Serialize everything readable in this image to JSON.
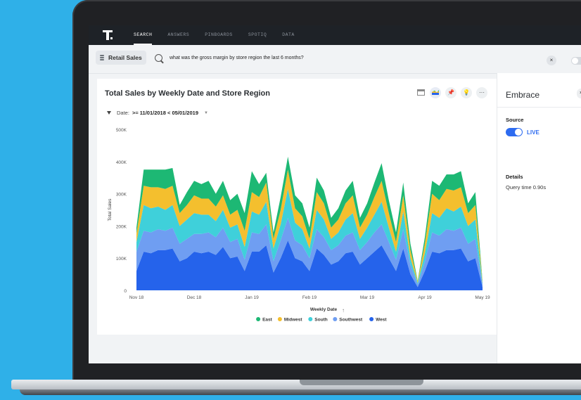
{
  "nav": {
    "items": [
      "SEARCH",
      "ANSWERS",
      "PINBOARDS",
      "SPOTIQ",
      "DATA"
    ],
    "active": "SEARCH"
  },
  "search": {
    "source": "Retail Sales",
    "query": "what was the gross margin by store region the last 6 months?",
    "clear_label": "×"
  },
  "chart_header": {
    "title": "Total Sales by Weekly Date and Store Region",
    "filter_label": "Date:",
    "filter_value": ">= 11/01/2018 < 05/01/2019",
    "more_label": "···"
  },
  "panel": {
    "title": "Embrace",
    "close_label": "×",
    "source_label": "Source",
    "source_value": "LIVE",
    "details_label": "Details",
    "details_value": "Query time 0.90s"
  },
  "chart_data": {
    "type": "area",
    "stacked": true,
    "title": "Total Sales by Weekly Date and Store Region",
    "xlabel": "Weekly Date",
    "ylabel": "Total Sales",
    "ylim": [
      0,
      500000
    ],
    "y_ticks": [
      "0",
      "100K",
      "200K",
      "300K",
      "400K",
      "500K"
    ],
    "x_ticks": [
      "Nov 18",
      "Dec 18",
      "Jan 19",
      "Feb 19",
      "Mar 19",
      "Apr 19",
      "May 19"
    ],
    "x_tick_index": [
      0,
      8,
      16,
      24,
      32,
      40,
      48
    ],
    "legend_position": "bottom",
    "series": [
      {
        "name": "West",
        "color": "#2563eb",
        "values": [
          60000,
          120000,
          115000,
          125000,
          125000,
          130000,
          90000,
          100000,
          120000,
          115000,
          120000,
          110000,
          135000,
          100000,
          105000,
          60000,
          120000,
          120000,
          140000,
          55000,
          100000,
          155000,
          100000,
          90000,
          60000,
          130000,
          110000,
          80000,
          90000,
          115000,
          120000,
          80000,
          100000,
          120000,
          140000,
          100000,
          60000,
          130000,
          50000,
          10000,
          60000,
          120000,
          115000,
          125000,
          125000,
          130000,
          90000,
          100000,
          10000
        ]
      },
      {
        "name": "Southwest",
        "color": "#6f9ef2",
        "values": [
          60000,
          65000,
          65000,
          65000,
          60000,
          65000,
          55000,
          60000,
          55000,
          60000,
          60000,
          55000,
          60000,
          50000,
          55000,
          35000,
          60000,
          55000,
          65000,
          35000,
          55000,
          70000,
          55000,
          50000,
          40000,
          60000,
          55000,
          45000,
          50000,
          55000,
          60000,
          45000,
          50000,
          60000,
          65000,
          50000,
          35000,
          60000,
          30000,
          8000,
          30000,
          60000,
          55000,
          65000,
          60000,
          65000,
          55000,
          60000,
          8000
        ]
      },
      {
        "name": "South",
        "color": "#3fd0da",
        "values": [
          30000,
          80000,
          75000,
          70000,
          65000,
          70000,
          55000,
          60000,
          65000,
          60000,
          55000,
          50000,
          55000,
          45000,
          45000,
          40000,
          65000,
          60000,
          70000,
          40000,
          50000,
          90000,
          55000,
          50000,
          30000,
          60000,
          55000,
          35000,
          40000,
          50000,
          60000,
          35000,
          45000,
          55000,
          70000,
          45000,
          25000,
          55000,
          20000,
          5000,
          25000,
          60000,
          55000,
          65000,
          60000,
          65000,
          55000,
          60000,
          5000
        ]
      },
      {
        "name": "Midwest",
        "color": "#f4bf2e",
        "values": [
          25000,
          60000,
          65000,
          60000,
          65000,
          60000,
          40000,
          45000,
          55000,
          50000,
          50000,
          45000,
          45000,
          40000,
          45000,
          50000,
          60000,
          55000,
          60000,
          30000,
          45000,
          60000,
          45000,
          40000,
          30000,
          55000,
          50000,
          35000,
          40000,
          50000,
          55000,
          35000,
          40000,
          55000,
          65000,
          45000,
          30000,
          50000,
          25000,
          5000,
          30000,
          60000,
          55000,
          60000,
          65000,
          60000,
          40000,
          45000,
          5000
        ]
      },
      {
        "name": "East",
        "color": "#1db874",
        "values": [
          20000,
          50000,
          55000,
          55000,
          60000,
          55000,
          25000,
          40000,
          45000,
          45000,
          55000,
          40000,
          45000,
          45000,
          50000,
          55000,
          65000,
          40000,
          30000,
          20000,
          40000,
          40000,
          40000,
          40000,
          35000,
          45000,
          40000,
          30000,
          35000,
          40000,
          45000,
          30000,
          35000,
          45000,
          55000,
          40000,
          30000,
          40000,
          20000,
          2000,
          20000,
          40000,
          45000,
          45000,
          50000,
          50000,
          30000,
          40000,
          2000
        ]
      }
    ]
  }
}
